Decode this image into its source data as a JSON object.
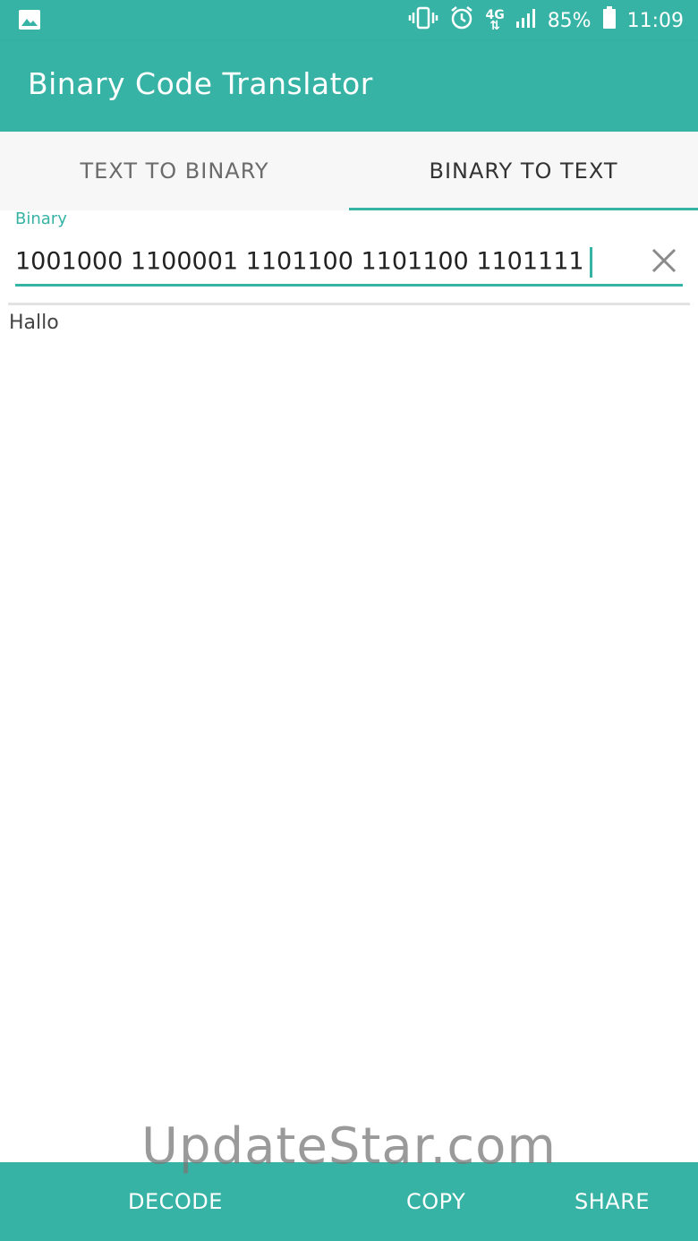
{
  "status_bar": {
    "battery_percent": "85%",
    "time": "11:09",
    "network": "4G",
    "icons": [
      "image-icon",
      "vibrate-icon",
      "alarm-icon",
      "network-4g-icon",
      "signal-icon",
      "battery-icon"
    ]
  },
  "app_bar": {
    "title": "Binary Code Translator"
  },
  "tabs": [
    {
      "label": "TEXT TO BINARY",
      "active": false
    },
    {
      "label": "BINARY TO TEXT",
      "active": true
    }
  ],
  "binary_input": {
    "label": "Binary",
    "value": "1001000 1100001 1101100 1101100 1101111"
  },
  "output": {
    "text": "Hallo"
  },
  "bottom_bar": {
    "decode_label": "DECODE",
    "copy_label": "COPY",
    "share_label": "SHARE"
  },
  "watermark": {
    "text": "UpdateStar.com"
  },
  "colors": {
    "accent": "#37b3a5",
    "tab_background": "#f7f7f7"
  }
}
